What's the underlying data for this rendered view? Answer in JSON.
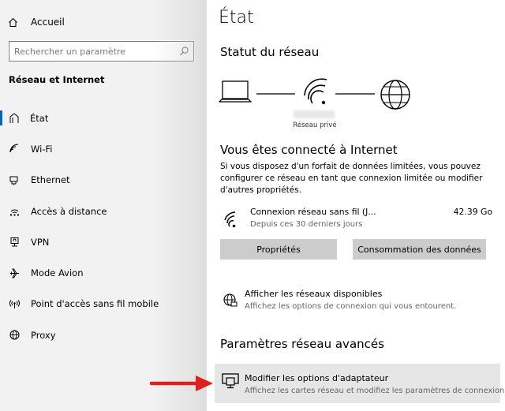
{
  "sidebar": {
    "home_label": "Accueil",
    "search_placeholder": "Rechercher un paramètre",
    "section_title": "Réseau et Internet",
    "items": [
      {
        "label": "État",
        "icon": "home-status-icon",
        "active": true
      },
      {
        "label": "Wi-Fi",
        "icon": "wifi-icon"
      },
      {
        "label": "Ethernet",
        "icon": "ethernet-icon"
      },
      {
        "label": "Accès à distance",
        "icon": "dialup-icon"
      },
      {
        "label": "VPN",
        "icon": "vpn-icon"
      },
      {
        "label": "Mode Avion",
        "icon": "airplane-icon"
      },
      {
        "label": "Point d'accès sans fil mobile",
        "icon": "hotspot-icon"
      },
      {
        "label": "Proxy",
        "icon": "globe-icon"
      }
    ]
  },
  "main": {
    "title": "État",
    "network_status_heading": "Statut du réseau",
    "network_type": "Réseau privé",
    "connected_heading": "Vous êtes connecté à Internet",
    "connected_text": "Si vous disposez d'un forfait de données limitées, vous pouvez configurer ce réseau en tant que connexion limitée ou modifier d'autres propriétés.",
    "connection": {
      "name": "Connexion réseau sans fil (J...",
      "data_used": "42.39 Go",
      "period": "Depuis ces 30 derniers jours"
    },
    "buttons": {
      "properties": "Propriétés",
      "data_usage": "Consommation des données"
    },
    "show_networks": {
      "title": "Afficher les réseaux disponibles",
      "subtitle": "Affichez les options de connexion qui vous entourent."
    },
    "advanced_heading": "Paramètres réseau avancés",
    "adapter_options": {
      "title": "Modifier les options d'adaptateur",
      "subtitle": "Affichez les cartes réseau et modifiez les paramètres de connexion."
    }
  },
  "colors": {
    "accent": "#0067c0",
    "sidebar_bg": "#f2f2f2",
    "button_bg": "#cccccc",
    "highlight_bg": "#e6e6e6",
    "annotation_arrow": "#e0201b"
  }
}
